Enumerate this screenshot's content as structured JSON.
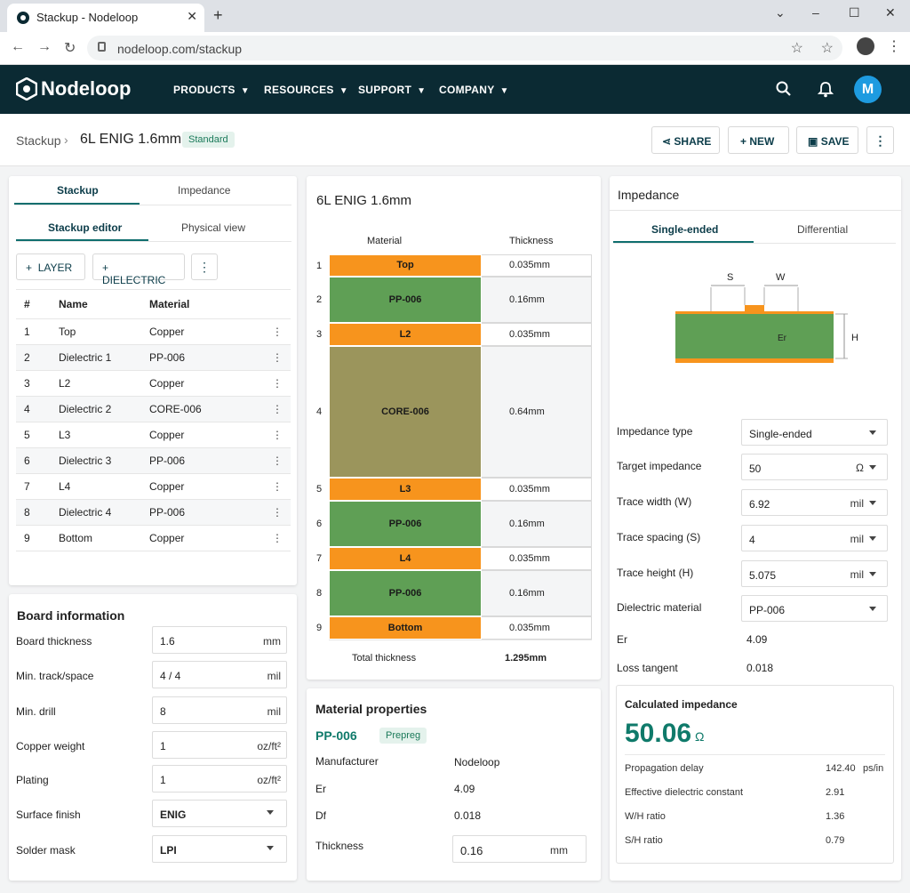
{
  "browser": {
    "tab_title": "Stackup - Nodeloop",
    "url": "nodeloop.com/stackup"
  },
  "site": {
    "brand": "Nodeloop",
    "menu": [
      "PRODUCTS",
      "RESOURCES",
      "SUPPORT",
      "COMPANY"
    ],
    "avatar_initial": "M"
  },
  "header": {
    "breadcrumb": "Stackup",
    "title": "6L ENIG 1.6mm",
    "badge": "Standard",
    "share": "SHARE",
    "new": "NEW",
    "save": "SAVE"
  },
  "left": {
    "tabs": [
      "Stackup",
      "Impedance"
    ],
    "subtabs": [
      "Stackup editor",
      "Physical view"
    ],
    "add_layer": "LAYER",
    "add_dielectric": "DIELECTRIC",
    "columns": [
      "#",
      "Name",
      "Material"
    ],
    "rows": [
      [
        "1",
        "Top",
        "Copper"
      ],
      [
        "2",
        "Dielectric 1",
        "PP-006"
      ],
      [
        "3",
        "L2",
        "Copper"
      ],
      [
        "4",
        "Dielectric 2",
        "CORE-006"
      ],
      [
        "5",
        "L3",
        "Copper"
      ],
      [
        "6",
        "Dielectric 3",
        "PP-006"
      ],
      [
        "7",
        "L4",
        "Copper"
      ],
      [
        "8",
        "Dielectric 4",
        "PP-006"
      ],
      [
        "9",
        "Bottom",
        "Copper"
      ]
    ]
  },
  "board": {
    "title": "Board information",
    "fields": [
      {
        "label": "Board thickness",
        "value": "1.6",
        "unit": "mm"
      },
      {
        "label": "Min. track/space",
        "value": "4 / 4",
        "unit": "mil"
      },
      {
        "label": "Min. drill",
        "value": "8",
        "unit": "mil"
      },
      {
        "label": "Copper weight",
        "value": "1",
        "unit": "oz/ft²"
      },
      {
        "label": "Plating",
        "value": "1",
        "unit": "oz/ft²"
      },
      {
        "label": "Surface finish",
        "value": "ENIG"
      },
      {
        "label": "Solder mask",
        "value": "LPI"
      }
    ]
  },
  "stack": {
    "title": "6L ENIG 1.6mm",
    "col_material": "Material",
    "col_thickness": "Thickness",
    "layers": [
      {
        "n": "1",
        "name": "Top",
        "thickness": "0.035mm",
        "color": "#f7941d"
      },
      {
        "n": "2",
        "name": "PP-006",
        "thickness": "0.16mm",
        "color": "#5f9f55"
      },
      {
        "n": "3",
        "name": "L2",
        "thickness": "0.035mm",
        "color": "#f7941d"
      },
      {
        "n": "4",
        "name": "CORE-006",
        "thickness": "0.64mm",
        "color": "#9b955c"
      },
      {
        "n": "5",
        "name": "L3",
        "thickness": "0.035mm",
        "color": "#f7941d"
      },
      {
        "n": "6",
        "name": "PP-006",
        "thickness": "0.16mm",
        "color": "#5f9f55"
      },
      {
        "n": "7",
        "name": "L4",
        "thickness": "0.035mm",
        "color": "#f7941d"
      },
      {
        "n": "8",
        "name": "PP-006",
        "thickness": "0.16mm",
        "color": "#5f9f55"
      },
      {
        "n": "9",
        "name": "Bottom",
        "thickness": "0.035mm",
        "color": "#f7941d"
      }
    ],
    "total_label": "Total thickness",
    "total_value": "1.295mm"
  },
  "material": {
    "title": "Material properties",
    "name": "PP-006",
    "type": "Prepreg",
    "props": [
      {
        "label": "Manufacturer",
        "value": "Nodeloop"
      },
      {
        "label": "Er",
        "value": "4.09"
      },
      {
        "label": "Df",
        "value": "0.018"
      }
    ],
    "thickness_label": "Thickness",
    "thickness_value": "0.16",
    "thickness_unit": "mm"
  },
  "impedance": {
    "title": "Impedance",
    "tabs": [
      "Single-ended",
      "Differential"
    ],
    "diagram": {
      "s": "S",
      "w": "W",
      "h": "H",
      "er": "Er"
    },
    "fields": [
      {
        "label": "Impedance type",
        "value": "Single-ended",
        "unit": ""
      },
      {
        "label": "Target impedance",
        "value": "50",
        "unit": "Ω"
      },
      {
        "label": "Trace width (W)",
        "value": "6.92",
        "unit": "mil"
      },
      {
        "label": "Trace spacing (S)",
        "value": "4",
        "unit": "mil"
      },
      {
        "label": "Trace height (H)",
        "value": "5.075",
        "unit": "mil"
      },
      {
        "label": "Dielectric material",
        "value": "PP-006",
        "unit": ""
      }
    ],
    "er_label": "Er",
    "er_value": "4.09",
    "loss_label": "Loss tangent",
    "loss_value": "0.018",
    "calc": {
      "title": "Calculated impedance",
      "value": "50.06",
      "unit": "Ω",
      "rows": [
        {
          "label": "Propagation delay",
          "value": "142.40",
          "unit": "ps/in"
        },
        {
          "label": "Effective dielectric constant",
          "value": "2.91",
          "unit": ""
        },
        {
          "label": "W/H ratio",
          "value": "1.36",
          "unit": ""
        },
        {
          "label": "S/H ratio",
          "value": "0.79",
          "unit": ""
        }
      ]
    }
  },
  "colors": {
    "brand": "#0b2a33",
    "accent": "#0f6e6e",
    "copper": "#f7941d",
    "prepreg": "#5f9f55",
    "core": "#9b955c",
    "avatar": "#1e9be0"
  }
}
